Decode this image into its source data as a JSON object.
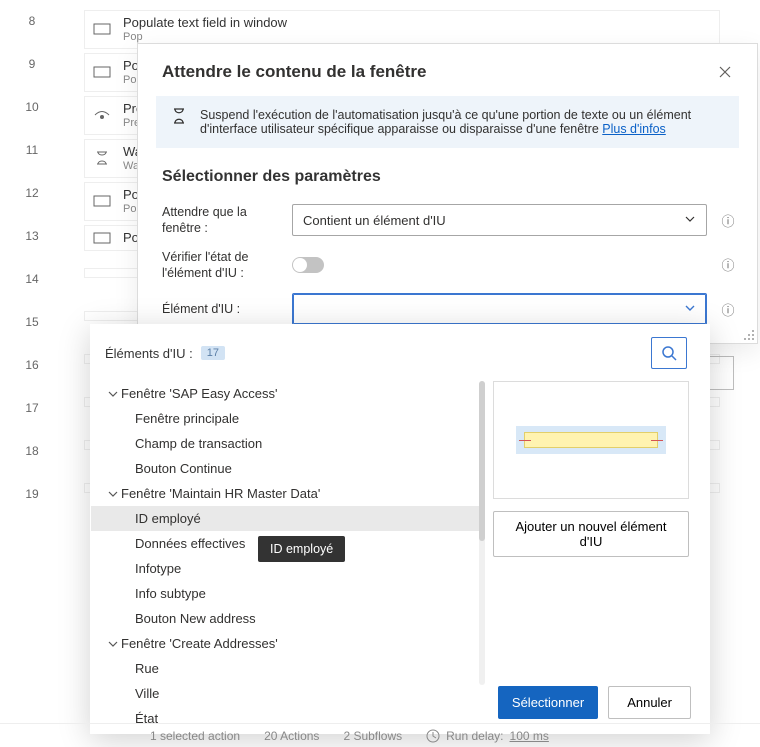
{
  "bg": {
    "rows": [
      {
        "n": "8",
        "title": "Populate text field in window",
        "sub": "Pop"
      },
      {
        "n": "9",
        "title": "Pop",
        "sub": "Pop"
      },
      {
        "n": "10",
        "title": "Pres",
        "sub": "Pres"
      },
      {
        "n": "11",
        "title": "Wai",
        "sub": "Wait"
      },
      {
        "n": "12",
        "title": "Pop",
        "sub": "Pop"
      },
      {
        "n": "13",
        "title": "Pop",
        "sub": ""
      },
      {
        "n": "14",
        "title": "",
        "sub": ""
      },
      {
        "n": "15",
        "title": "",
        "sub": ""
      },
      {
        "n": "16",
        "title": "",
        "sub": ""
      },
      {
        "n": "17",
        "title": "",
        "sub": ""
      },
      {
        "n": "18",
        "title": "",
        "sub": ""
      },
      {
        "n": "19",
        "title": "",
        "sub": ""
      }
    ],
    "icons": [
      "rect",
      "rect",
      "cursor",
      "hourglass",
      "rect",
      "rect",
      "",
      "",
      "",
      "",
      "",
      ""
    ]
  },
  "dialog": {
    "title": "Attendre le contenu de la fenêtre",
    "info": "Suspend l'exécution de l'automatisation jusqu'à ce qu'une portion de texte ou un élément d'interface utilisateur spécifique apparaisse ou disparaisse d'une fenêtre ",
    "info_link": "Plus d'infos",
    "section": "Sélectionner des paramètres",
    "field_wait_label": "Attendre que la fenêtre :",
    "field_wait_value": "Contient un élément d'IU",
    "field_check_label": "Vérifier l'état de l'élément d'IU :",
    "field_ui_label": "Élément d'IU :"
  },
  "popover": {
    "header": "Éléments d'IU :",
    "count": "17",
    "add_label": "Ajouter un nouvel élément d'IU",
    "select_label": "Sélectionner",
    "cancel_label": "Annuler",
    "tooltip": "ID employé",
    "tree": [
      {
        "level": 0,
        "expanded": true,
        "label": "Fenêtre 'SAP Easy Access'"
      },
      {
        "level": 1,
        "label": "Fenêtre principale"
      },
      {
        "level": 1,
        "label": "Champ de transaction"
      },
      {
        "level": 1,
        "label": "Bouton Continue"
      },
      {
        "level": 0,
        "expanded": true,
        "label": "Fenêtre 'Maintain HR Master Data'"
      },
      {
        "level": 1,
        "label": "ID employé",
        "selected": true
      },
      {
        "level": 1,
        "label": "Données effectives"
      },
      {
        "level": 1,
        "label": "Infotype"
      },
      {
        "level": 1,
        "label": "Info subtype"
      },
      {
        "level": 1,
        "label": "Bouton New address"
      },
      {
        "level": 0,
        "expanded": true,
        "label": "Fenêtre 'Create Addresses'"
      },
      {
        "level": 1,
        "label": "Rue"
      },
      {
        "level": 1,
        "label": "Ville"
      },
      {
        "level": 1,
        "label": "État"
      }
    ]
  },
  "status": {
    "a": "1 selected action",
    "b": "20 Actions",
    "c": "2 Subflows",
    "d": "Run delay:",
    "e": "100 ms"
  }
}
